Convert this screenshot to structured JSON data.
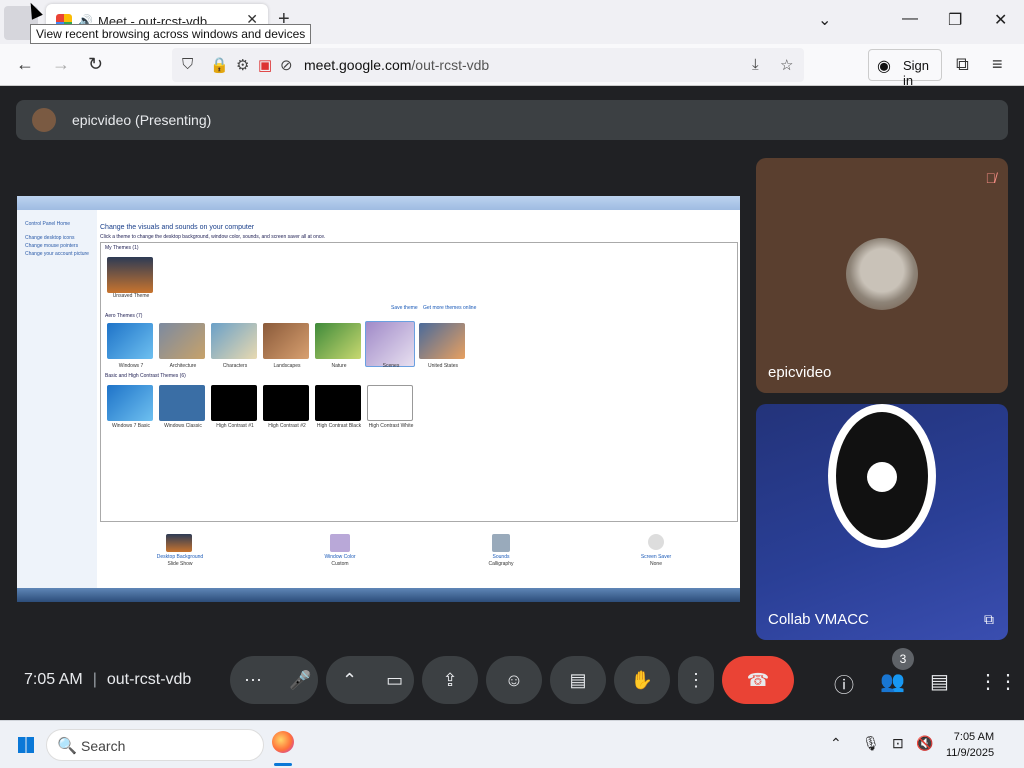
{
  "browser": {
    "tab_title": "Meet - out-rcst-vdb",
    "tooltip": "View recent browsing across windows and devices",
    "url_host": "meet.google.com",
    "url_path": "/out-rcst-vdb",
    "sign_in_label": "Sign in"
  },
  "meet": {
    "presenting_label": "epicvideo (Presenting)",
    "shared_screen": {
      "heading": "Change the visuals and sounds on your computer",
      "subheading": "Click a theme to change the desktop background, window color, sounds, and screen saver all at once.",
      "left_nav": [
        "Control Panel Home",
        "Change desktop icons",
        "Change mouse pointers",
        "Change your account picture"
      ],
      "my_themes_label": "My Themes (1)",
      "aero_themes_label": "Aero Themes (7)",
      "basic_themes_label": "Basic and High Contrast Themes (6)",
      "links": [
        "Save theme",
        "Get more themes online"
      ],
      "aero_themes": [
        "Windows 7",
        "Architecture",
        "Characters",
        "Landscapes",
        "Nature",
        "Scenes",
        "United States"
      ],
      "basic_themes": [
        "Windows 7 Basic",
        "Windows Classic",
        "High Contrast #1",
        "High Contrast #2",
        "High Contrast Black",
        "High Contrast White"
      ],
      "bottom_items": [
        {
          "title": "Desktop Background",
          "value": "Slide Show"
        },
        {
          "title": "Window Color",
          "value": "Custom"
        },
        {
          "title": "Sounds",
          "value": "Calligraphy"
        },
        {
          "title": "Screen Saver",
          "value": "None"
        }
      ],
      "unsaved_theme": "Unsaved Theme"
    },
    "participants": [
      {
        "name": "epicvideo",
        "muted": true
      },
      {
        "name": "Collab VMACC"
      }
    ],
    "time": "7:05 AM",
    "meeting_code": "out-rcst-vdb",
    "people_count": "3"
  },
  "taskbar": {
    "search_placeholder": "Search",
    "time": "7:05 AM",
    "date": "11/9/2025"
  },
  "colors": {
    "end_call": "#ea4335",
    "meet_bg": "#202124",
    "control_bg": "#3c4043"
  }
}
